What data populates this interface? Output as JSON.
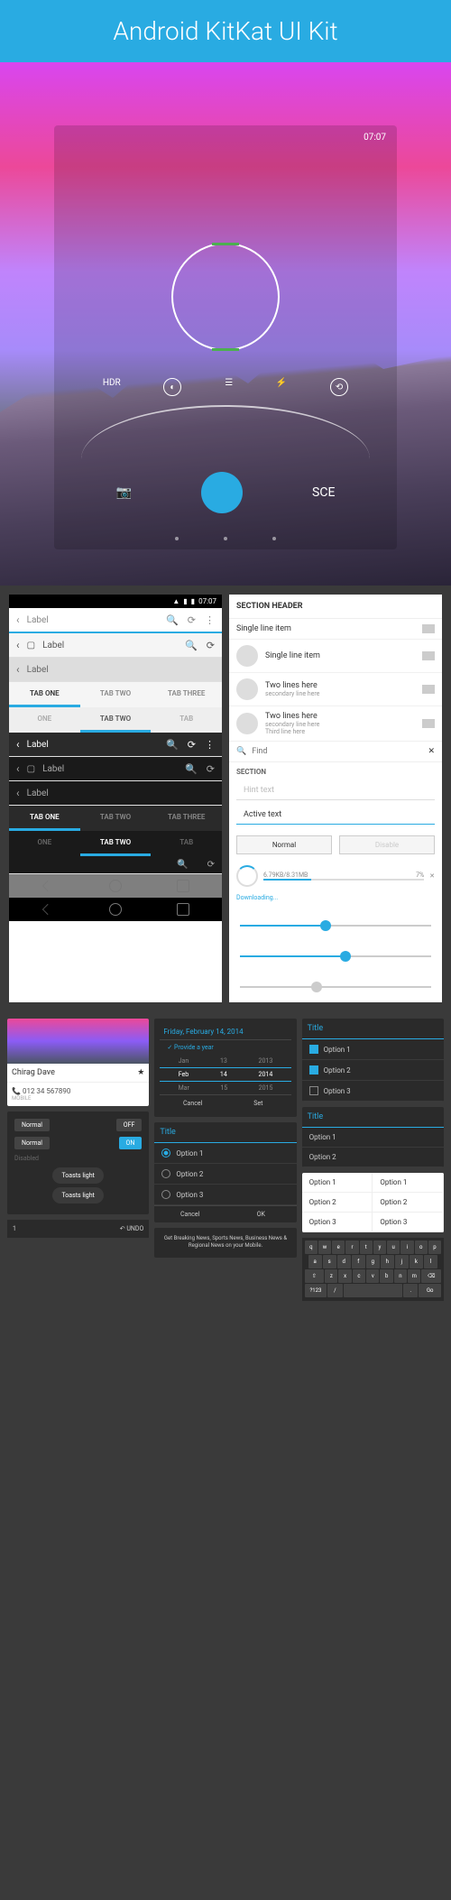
{
  "hero": {
    "title": "Android KitKat UI Kit",
    "time": "07:07",
    "hdr": "HDR",
    "sce": "SCE"
  },
  "status": {
    "time": "07:07"
  },
  "actionbars": {
    "light": {
      "label": "Label"
    },
    "white": {
      "label": "Label"
    },
    "gray": {
      "label": "Label"
    },
    "dark": {
      "label": "Label"
    },
    "darker": {
      "label": "Label"
    },
    "darkest": {
      "label": "Label"
    }
  },
  "tabs_light": [
    "TAB ONE",
    "TAB TWO",
    "TAB THREE"
  ],
  "tabs_scroll": [
    "ONE",
    "TAB TWO",
    "TAB"
  ],
  "tabs_dark": [
    "TAB ONE",
    "TAB TWO",
    "TAB THREE"
  ],
  "tabs_dscroll": [
    "ONE",
    "TAB TWO",
    "TAB"
  ],
  "list": {
    "header": "SECTION HEADER",
    "item1": "Single line item",
    "item2": "Single line item",
    "item3": {
      "p": "Two lines here",
      "s": "secondary line here"
    },
    "item4": {
      "p": "Two lines here",
      "s": "secondary line here",
      "t": "Third line here"
    }
  },
  "find": {
    "placeholder": "Find"
  },
  "section2": "SECTION",
  "inputs": {
    "hint": "Hint text",
    "active": "Active text"
  },
  "buttons": {
    "normal": "Normal",
    "disable": "Disable"
  },
  "progress": {
    "text": "6.79KB/8.31MB",
    "pct": "7%",
    "downloading": "Downloading..."
  },
  "contact": {
    "name": "Chirag Dave",
    "phone": "012 34 567890",
    "type": "MOBILE"
  },
  "toggles": {
    "normal": "Normal",
    "disabled": "Disabled",
    "off": "OFF",
    "on": "ON"
  },
  "toasts": {
    "t1": "Toasts light",
    "t2": "Toasts light"
  },
  "undo": {
    "count": "1",
    "label": "UNDO"
  },
  "datepicker": {
    "header": "Friday, February 14, 2014",
    "provide": "Provide a year",
    "r1": [
      "Jan",
      "13",
      "2013"
    ],
    "r2": [
      "Feb",
      "14",
      "2014"
    ],
    "r3": [
      "Mar",
      "15",
      "2015"
    ],
    "cancel": "Cancel",
    "set": "Set"
  },
  "dialog": {
    "title": "Title",
    "opts": [
      "Option 1",
      "Option 2",
      "Option 3"
    ],
    "cancel": "Cancel",
    "ok": "OK"
  },
  "toast_msg": "Get Breaking News, Sports News, Business News & Regional News on your Mobile.",
  "dlg_title2": "Title",
  "checklist": {
    "opts": [
      "Option 1",
      "Option 2",
      "Option 3"
    ]
  },
  "menu": {
    "opts": [
      "Option 1",
      "Option 2",
      "Option 3"
    ]
  },
  "keyboard": {
    "r1": [
      "q",
      "w",
      "e",
      "r",
      "t",
      "y",
      "u",
      "i",
      "o",
      "p"
    ],
    "r2": [
      "a",
      "s",
      "d",
      "f",
      "g",
      "h",
      "j",
      "k",
      "l"
    ],
    "r3": [
      "⇧",
      "z",
      "x",
      "c",
      "v",
      "b",
      "n",
      "m",
      "⌫"
    ],
    "r4": [
      "?123",
      "/",
      ".",
      "Go"
    ]
  }
}
